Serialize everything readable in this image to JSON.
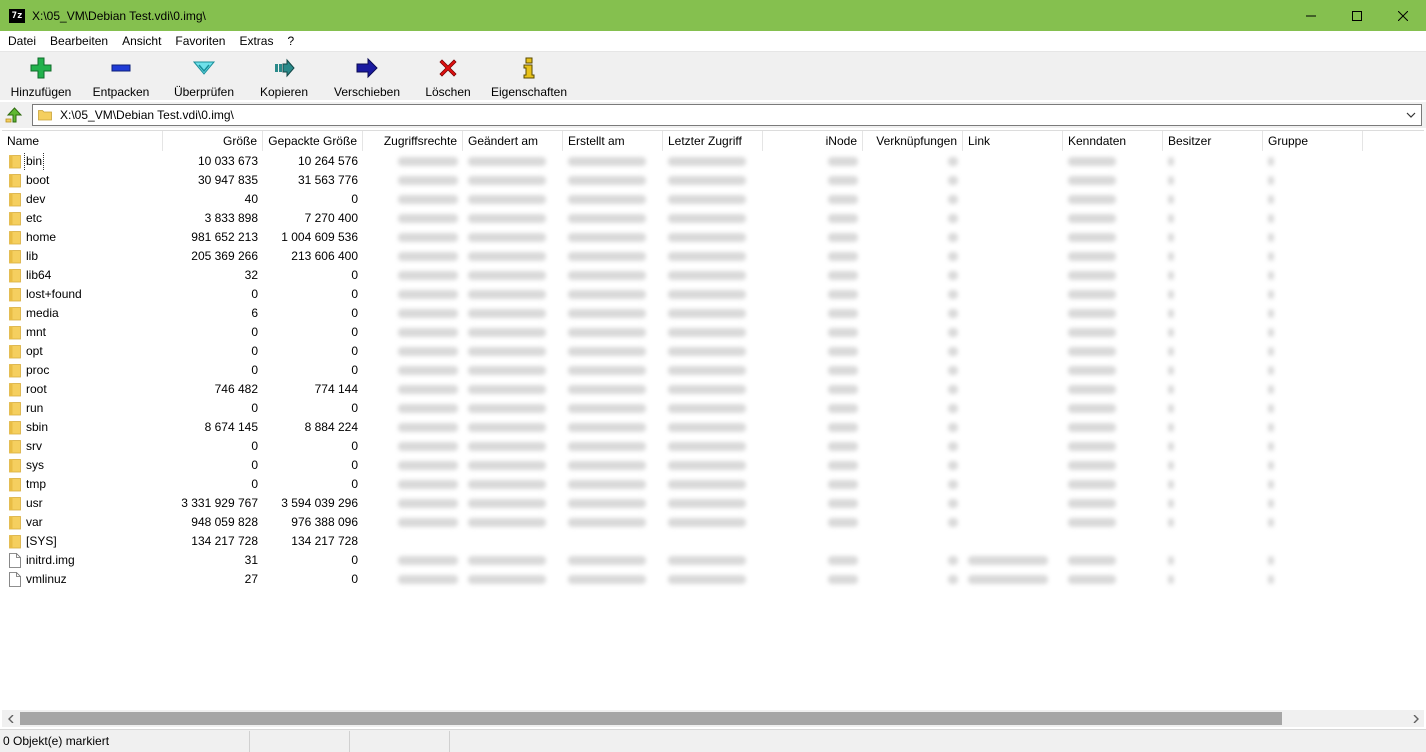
{
  "window": {
    "icon_text": "7z",
    "title": "X:\\05_VM\\Debian Test.vdi\\0.img\\",
    "controls": [
      "minimize",
      "maximize",
      "close"
    ]
  },
  "menu": [
    "Datei",
    "Bearbeiten",
    "Ansicht",
    "Favoriten",
    "Extras",
    "?"
  ],
  "toolbar": [
    {
      "label": "Hinzufügen",
      "icon": "plus-icon",
      "color": "#22b14c"
    },
    {
      "label": "Entpacken",
      "icon": "minus-icon",
      "color": "#1f3bd6"
    },
    {
      "label": "Überprüfen",
      "icon": "check-down-icon",
      "color": "#3cc8d8"
    },
    {
      "label": "Kopieren",
      "icon": "copy-arrow-icon",
      "color": "#2a8a8a"
    },
    {
      "label": "Verschieben",
      "icon": "move-arrow-icon",
      "color": "#1a1aa0"
    },
    {
      "label": "Löschen",
      "icon": "delete-x-icon",
      "color": "#e01010"
    },
    {
      "label": "Eigenschaften",
      "icon": "info-icon",
      "color": "#e8c21a"
    }
  ],
  "address": {
    "path": "X:\\05_VM\\Debian Test.vdi\\0.img\\"
  },
  "columns": [
    "Name",
    "Größe",
    "Gepackte Größe",
    "Zugriffsrechte",
    "Geändert am",
    "Erstellt am",
    "Letzter Zugriff",
    "iNode",
    "Verknüpfungen",
    "Link",
    "Kenndaten",
    "Besitzer",
    "Gruppe"
  ],
  "files": [
    {
      "name": "bin",
      "type": "folder",
      "size": "10 033 673",
      "packed": "10 264 576"
    },
    {
      "name": "boot",
      "type": "folder",
      "size": "30 947 835",
      "packed": "31 563 776"
    },
    {
      "name": "dev",
      "type": "folder",
      "size": "40",
      "packed": "0"
    },
    {
      "name": "etc",
      "type": "folder",
      "size": "3 833 898",
      "packed": "7 270 400"
    },
    {
      "name": "home",
      "type": "folder",
      "size": "981 652 213",
      "packed": "1 004 609 536"
    },
    {
      "name": "lib",
      "type": "folder",
      "size": "205 369 266",
      "packed": "213 606 400"
    },
    {
      "name": "lib64",
      "type": "folder",
      "size": "32",
      "packed": "0"
    },
    {
      "name": "lost+found",
      "type": "folder",
      "size": "0",
      "packed": "0"
    },
    {
      "name": "media",
      "type": "folder",
      "size": "6",
      "packed": "0"
    },
    {
      "name": "mnt",
      "type": "folder",
      "size": "0",
      "packed": "0"
    },
    {
      "name": "opt",
      "type": "folder",
      "size": "0",
      "packed": "0"
    },
    {
      "name": "proc",
      "type": "folder",
      "size": "0",
      "packed": "0"
    },
    {
      "name": "root",
      "type": "folder",
      "size": "746 482",
      "packed": "774 144"
    },
    {
      "name": "run",
      "type": "folder",
      "size": "0",
      "packed": "0"
    },
    {
      "name": "sbin",
      "type": "folder",
      "size": "8 674 145",
      "packed": "8 884 224"
    },
    {
      "name": "srv",
      "type": "folder",
      "size": "0",
      "packed": "0"
    },
    {
      "name": "sys",
      "type": "folder",
      "size": "0",
      "packed": "0"
    },
    {
      "name": "tmp",
      "type": "folder",
      "size": "0",
      "packed": "0"
    },
    {
      "name": "usr",
      "type": "folder",
      "size": "3 331 929 767",
      "packed": "3 594 039 296"
    },
    {
      "name": "var",
      "type": "folder",
      "size": "948 059 828",
      "packed": "976 388 096"
    },
    {
      "name": "[SYS]",
      "type": "folder",
      "size": "134 217 728",
      "packed": "134 217 728"
    },
    {
      "name": "initrd.img",
      "type": "file",
      "size": "31",
      "packed": "0"
    },
    {
      "name": "vmlinuz",
      "type": "file",
      "size": "27",
      "packed": "0"
    }
  ],
  "status": {
    "selection": "0 Objekt(e) markiert"
  },
  "colors": {
    "titlebar": "#85c04f",
    "folder": "#f5cf5f"
  }
}
